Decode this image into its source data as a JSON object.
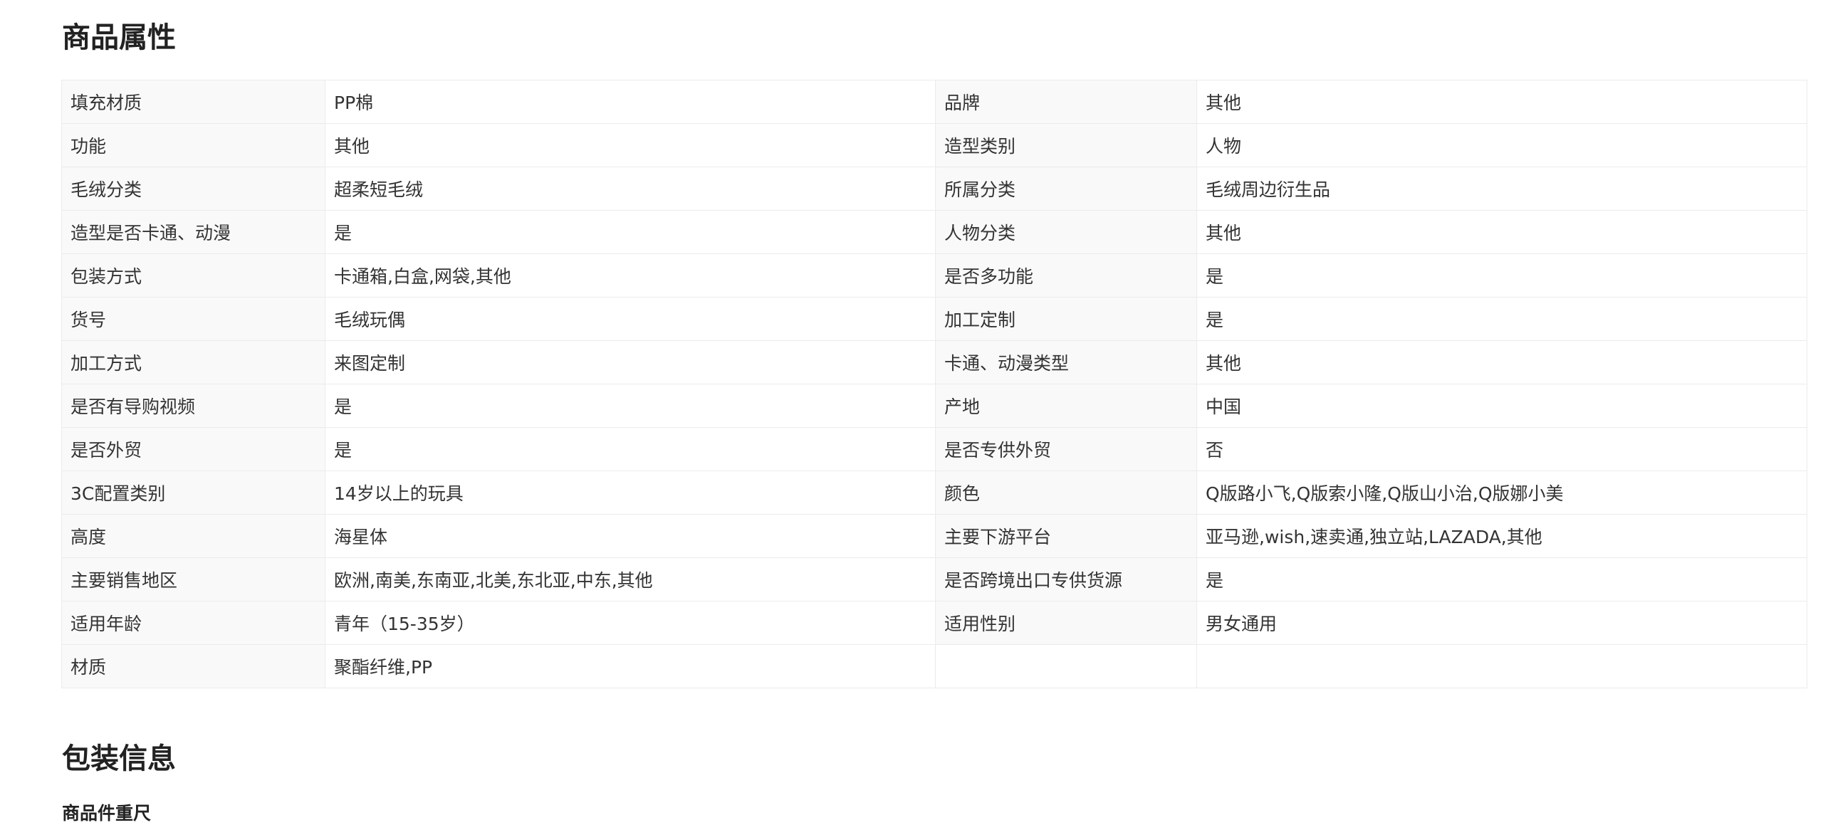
{
  "sections": {
    "attributes_title": "商品属性",
    "packaging_title": "包装信息",
    "packaging_subtitle": "商品件重尺"
  },
  "attributes": [
    {
      "left_key": "填充材质",
      "left_value": "PP棉",
      "right_key": "品牌",
      "right_value": "其他"
    },
    {
      "left_key": "功能",
      "left_value": "其他",
      "right_key": "造型类别",
      "right_value": "人物"
    },
    {
      "left_key": "毛绒分类",
      "left_value": "超柔短毛绒",
      "right_key": "所属分类",
      "right_value": "毛绒周边衍生品"
    },
    {
      "left_key": "造型是否卡通、动漫",
      "left_value": "是",
      "right_key": "人物分类",
      "right_value": "其他"
    },
    {
      "left_key": "包装方式",
      "left_value": "卡通箱,白盒,网袋,其他",
      "right_key": "是否多功能",
      "right_value": "是"
    },
    {
      "left_key": "货号",
      "left_value": "毛绒玩偶",
      "right_key": "加工定制",
      "right_value": "是"
    },
    {
      "left_key": "加工方式",
      "left_value": "来图定制",
      "right_key": "卡通、动漫类型",
      "right_value": "其他"
    },
    {
      "left_key": "是否有导购视频",
      "left_value": "是",
      "right_key": "产地",
      "right_value": "中国"
    },
    {
      "left_key": "是否外贸",
      "left_value": "是",
      "right_key": "是否专供外贸",
      "right_value": "否"
    },
    {
      "left_key": "3C配置类别",
      "left_value": "14岁以上的玩具",
      "right_key": "颜色",
      "right_value": "Q版路小飞,Q版索小隆,Q版山小治,Q版娜小美"
    },
    {
      "left_key": "高度",
      "left_value": "海星体",
      "right_key": "主要下游平台",
      "right_value": "亚马逊,wish,速卖通,独立站,LAZADA,其他"
    },
    {
      "left_key": "主要销售地区",
      "left_value": "欧洲,南美,东南亚,北美,东北亚,中东,其他",
      "right_key": "是否跨境出口专供货源",
      "right_value": "是"
    },
    {
      "left_key": "适用年龄",
      "left_value": "青年（15-35岁）",
      "right_key": "适用性别",
      "right_value": "男女通用"
    },
    {
      "left_key": "材质",
      "left_value": "聚酯纤维,PP",
      "right_key": "",
      "right_value": ""
    }
  ]
}
